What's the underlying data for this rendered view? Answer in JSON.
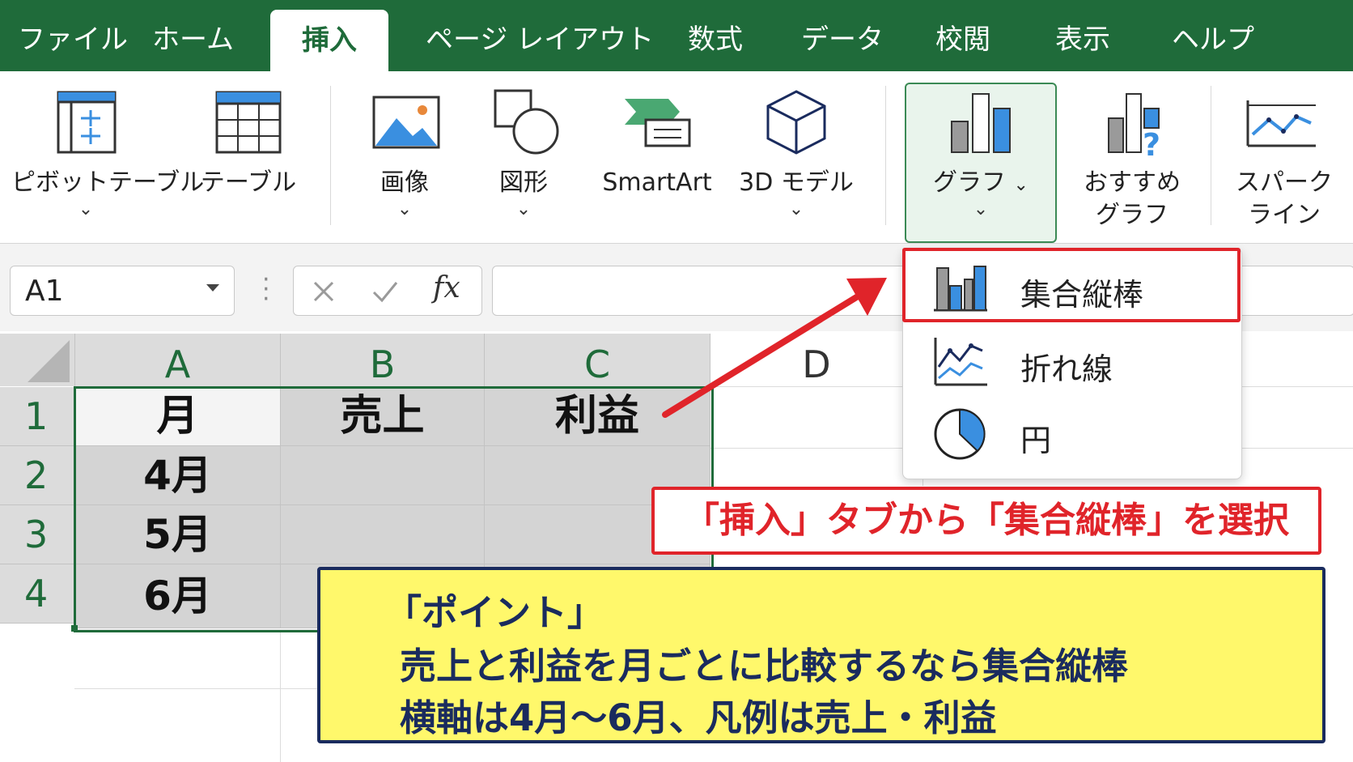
{
  "tabs": [
    {
      "label": "ファイル"
    },
    {
      "label": "ホーム"
    },
    {
      "label": "挿入"
    },
    {
      "label": "ページ レイアウト"
    },
    {
      "label": "数式"
    },
    {
      "label": "データ"
    },
    {
      "label": "校閲"
    },
    {
      "label": "表示"
    },
    {
      "label": "ヘルプ"
    }
  ],
  "active_tab": "挿入",
  "ribbon": {
    "pivot": "ピボットテーブル",
    "table": "テーブル",
    "image": "画像",
    "shapes": "図形",
    "smartart": "SmartArt",
    "model3d": "3D モデル",
    "chart": "グラフ",
    "recommended_1": "おすすめ",
    "recommended_2": "グラフ",
    "sparkline_1": "スパーク",
    "sparkline_2": "ライン",
    "chevron": "⌄"
  },
  "formula_bar": {
    "name_box": "A1",
    "fx": "fx",
    "value": ""
  },
  "sheet": {
    "columns": [
      "A",
      "B",
      "C",
      "D"
    ],
    "rows": [
      "1",
      "2",
      "3",
      "4"
    ],
    "cells": {
      "A1": "月",
      "B1": "売上",
      "C1": "利益",
      "A2": "4月",
      "A3": "5月",
      "A4": "6月"
    }
  },
  "chart_menu": {
    "items": [
      {
        "label": "集合縦棒",
        "icon": "clustered-column-icon",
        "highlighted": true
      },
      {
        "label": "折れ線",
        "icon": "line-chart-icon",
        "highlighted": false
      },
      {
        "label": "円",
        "icon": "pie-chart-icon",
        "highlighted": false
      }
    ]
  },
  "annotations": {
    "instruction": "「挿入」タブから「集合縦棒」を選択",
    "point_title": "「ポイント」",
    "point_line1": "売上と利益を月ごとに比較するなら集合縦棒",
    "point_line2": "横軸は4月～6月、凡例は売上・利益"
  },
  "colors": {
    "excel_green": "#1f6b3a",
    "highlight_red": "#e0242a",
    "note_yellow": "#fff86b",
    "note_navy": "#1a2b5e",
    "chart_blue": "#3a8fe0"
  }
}
